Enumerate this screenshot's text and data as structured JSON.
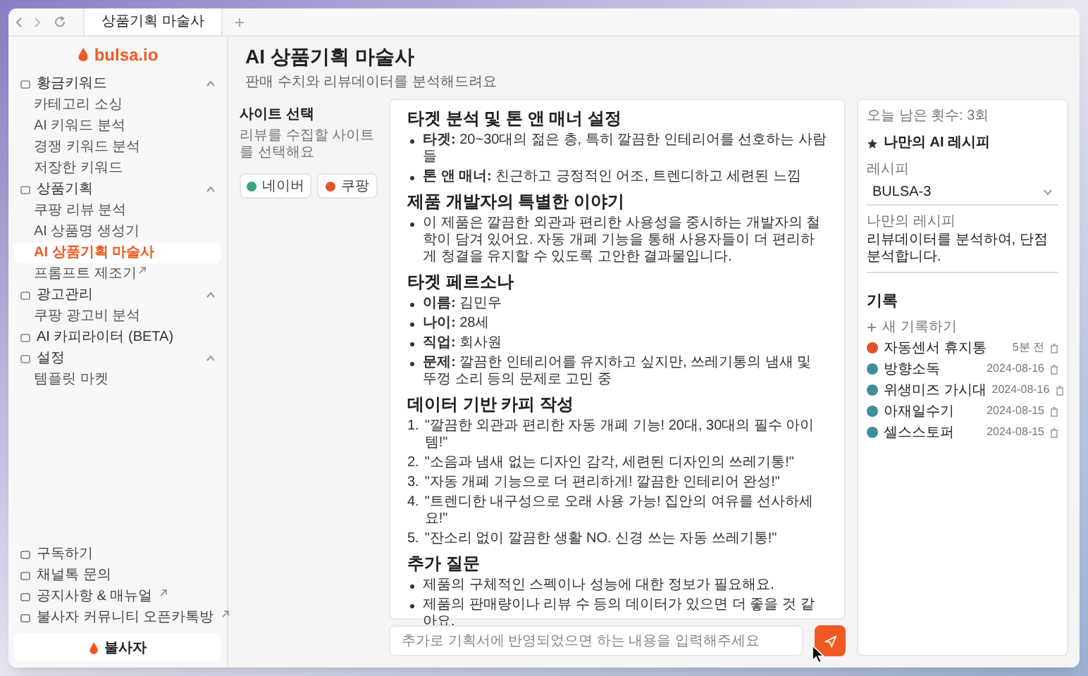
{
  "browser_bar": {
    "tab_title": "상품기획 마술사"
  },
  "sidebar": {
    "logo": "bulsa.io",
    "sections": [
      {
        "kind": "group",
        "label": "황금키워드",
        "expanded": true,
        "children": [
          {
            "label": "카테고리 소싱",
            "selected": false,
            "external": false
          },
          {
            "label": "AI 키워드 분석",
            "selected": false,
            "external": false
          },
          {
            "label": "경쟁 키워드 분석",
            "selected": false,
            "external": false
          },
          {
            "label": "저장한 키워드",
            "selected": false,
            "external": false
          }
        ]
      },
      {
        "kind": "group",
        "label": "상품기획",
        "expanded": true,
        "children": [
          {
            "label": "쿠팡 리뷰 분석",
            "selected": false,
            "external": false
          },
          {
            "label": "AI 상품명 생성기",
            "selected": false,
            "external": false
          },
          {
            "label": "AI 상품기획 마술사",
            "selected": true,
            "external": false
          },
          {
            "label": "프롬프트 제조기",
            "selected": false,
            "external": true
          }
        ]
      },
      {
        "kind": "group",
        "label": "광고관리",
        "expanded": true,
        "children": [
          {
            "label": "쿠팡 광고비 분석",
            "selected": false,
            "external": false
          }
        ]
      },
      {
        "kind": "link",
        "label": "AI 카피라이터 (BETA)"
      },
      {
        "kind": "group",
        "label": "설정",
        "expanded": true,
        "children": [
          {
            "label": "템플릿 마켓",
            "selected": false,
            "external": false
          }
        ]
      }
    ],
    "footer_links": [
      {
        "label": "구독하기",
        "external": false
      },
      {
        "label": "채널톡 문의",
        "external": false
      },
      {
        "label": "공지사항 & 매뉴얼",
        "external": true
      },
      {
        "label": "불사자 커뮤니티 오픈카톡방",
        "external": true
      }
    ],
    "user": "불사자"
  },
  "page": {
    "title": "AI 상품기획 마술사",
    "subtitle": "판매 수치와 리뷰데이터를 분석해드려요"
  },
  "site_select": {
    "title": "사이트 선택",
    "hint": "리뷰를 수집할 사이트를 선택해요",
    "options": [
      {
        "label": "네이버",
        "selected": false,
        "color": "#3aa37a"
      },
      {
        "label": "쿠팡",
        "selected": false,
        "color": "#e0532a"
      }
    ]
  },
  "chat": {
    "sections": [
      {
        "heading": "타겟 분석 및 톤 앤 매너 설정",
        "kind": "bullets",
        "items": [
          "**타겟:** 20~30대의 젊은 층, 특히 깔끔한 인테리어를 선호하는 사람들",
          "**톤 앤 매너:** 친근하고 긍정적인 어조, 트렌디하고 세련된 느낌"
        ]
      },
      {
        "heading": "제품 개발자의 특별한 이야기",
        "kind": "bullets",
        "items": [
          "이 제품은 깔끔한 외관과 편리한 사용성을 중시하는 개발자의 철학이 담겨 있어요. 자동 개폐 기능을 통해 사용자들이 더 편리하게 청결을 유지할 수 있도록 고안한 결과물입니다."
        ]
      },
      {
        "heading": "타겟 페르소나",
        "kind": "bullets",
        "items": [
          "**이름:** 김민우",
          "**나이:** 28세",
          "**직업:** 회사원",
          "**문제:** 깔끔한 인테리어를 유지하고 싶지만, 쓰레기통의 냄새 및 뚜껑 소리 등의 문제로 고민 중"
        ]
      },
      {
        "heading": "데이터 기반 카피 작성",
        "kind": "numbered",
        "items": [
          {
            "number": "1.",
            "text": "\"깔끔한 외관과 편리한 자동 개폐 기능! 20대, 30대의 필수 아이템!\""
          },
          {
            "number": "2.",
            "text": "\"소음과 냄새 없는 디자인 감각, 세련된 디자인의 쓰레기통!\""
          },
          {
            "number": "3.",
            "text": "\"자동 개폐 기능으로 더 편리하게! 깔끔한 인테리어 완성!\""
          },
          {
            "number": "4.",
            "text": "\"트렌디한 내구성으로 오래 사용 가능! 집안의 여유를 선사하세요!\""
          },
          {
            "number": "5.",
            "text": "\"잔소리 없이 깔끔한 생활 NO. 신경 쓰는 자동 쓰레기통!\""
          }
        ]
      },
      {
        "heading": "추가 질문",
        "kind": "bullets",
        "items": [
          "제품의 구체적인 스펙이나 성능에 대한 정보가 필요해요.",
          "제품의 판매량이나 리뷰 수 등의 데이터가 있으면 더 좋을 것 같아요."
        ]
      }
    ],
    "input": {
      "placeholder": "추가로 기획서에 반영되었으면 하는 내용을 입력해주세요"
    }
  },
  "right_panel": {
    "quota": "오늘 남은 횟수: 3회",
    "recipe_title": "나만의 AI 레시피",
    "recipe_label": "레시피",
    "recipe_value": "BULSA-3",
    "prompt_label": "나만의 레시피",
    "prompt_value": "리뷰데이터를 분석하여, 단점 분석합니다.",
    "history_title": "기록",
    "new_label": "새 기록하기",
    "history": [
      {
        "name": "자동센서 휴지통",
        "time": "5분 전",
        "color": "#e0532a"
      },
      {
        "name": "방향소독",
        "time": "2024-08-16",
        "color": "#3f8f9a"
      },
      {
        "name": "위생미즈 가시대",
        "time": "2024-08-16",
        "color": "#3f8f9a"
      },
      {
        "name": "아재일수기",
        "time": "2024-08-15",
        "color": "#3f8f9a"
      },
      {
        "name": "셀스스토퍼",
        "time": "2024-08-15",
        "color": "#3f8f9a"
      }
    ]
  }
}
